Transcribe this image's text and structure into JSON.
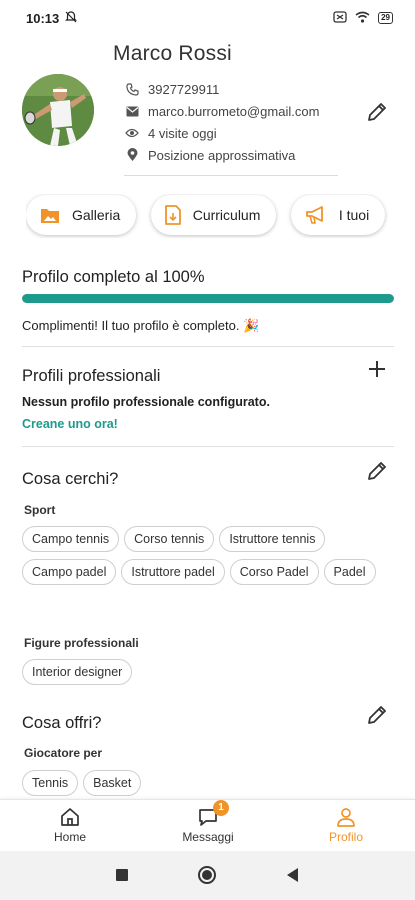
{
  "status_bar": {
    "time": "10:13",
    "battery": "29"
  },
  "profile": {
    "name": "Marco Rossi",
    "phone": "3927729911",
    "email": "marco.burrometo@gmail.com",
    "visits": "4 visite oggi",
    "location": "Posizione approssimativa"
  },
  "action_chips": [
    {
      "label": "Galleria",
      "icon": "gallery-icon"
    },
    {
      "label": "Curriculum",
      "icon": "document-icon"
    },
    {
      "label": "I tuoi",
      "icon": "megaphone-icon"
    }
  ],
  "completion": {
    "title": "Profilo completo al 100%",
    "percent": 100,
    "message": "Complimenti! Il tuo profilo è completo. 🎉",
    "accent_color": "#1e9a8c"
  },
  "professional": {
    "title": "Profili professionali",
    "empty_message": "Nessun profilo professionale configurato.",
    "create_link": "Creane uno ora!"
  },
  "looking_for": {
    "title": "Cosa cerchi?",
    "groups": [
      {
        "label": "Sport",
        "tags": [
          "Campo tennis",
          "Corso tennis",
          "Istruttore tennis",
          "Campo padel",
          "Istruttore padel",
          "Corso Padel",
          "Padel"
        ]
      },
      {
        "label": "Figure professionali",
        "tags": [
          "Interior designer"
        ]
      }
    ]
  },
  "offering": {
    "title": "Cosa offri?",
    "groups": [
      {
        "label": "Giocatore per",
        "tags": [
          "Tennis",
          "Basket"
        ]
      }
    ]
  },
  "bottom_nav": {
    "items": [
      {
        "label": "Home",
        "icon": "home-icon"
      },
      {
        "label": "Messaggi",
        "icon": "chat-icon",
        "badge": "1"
      },
      {
        "label": "Profilo",
        "icon": "person-icon",
        "active": true
      }
    ],
    "active_color": "#f0942a"
  }
}
